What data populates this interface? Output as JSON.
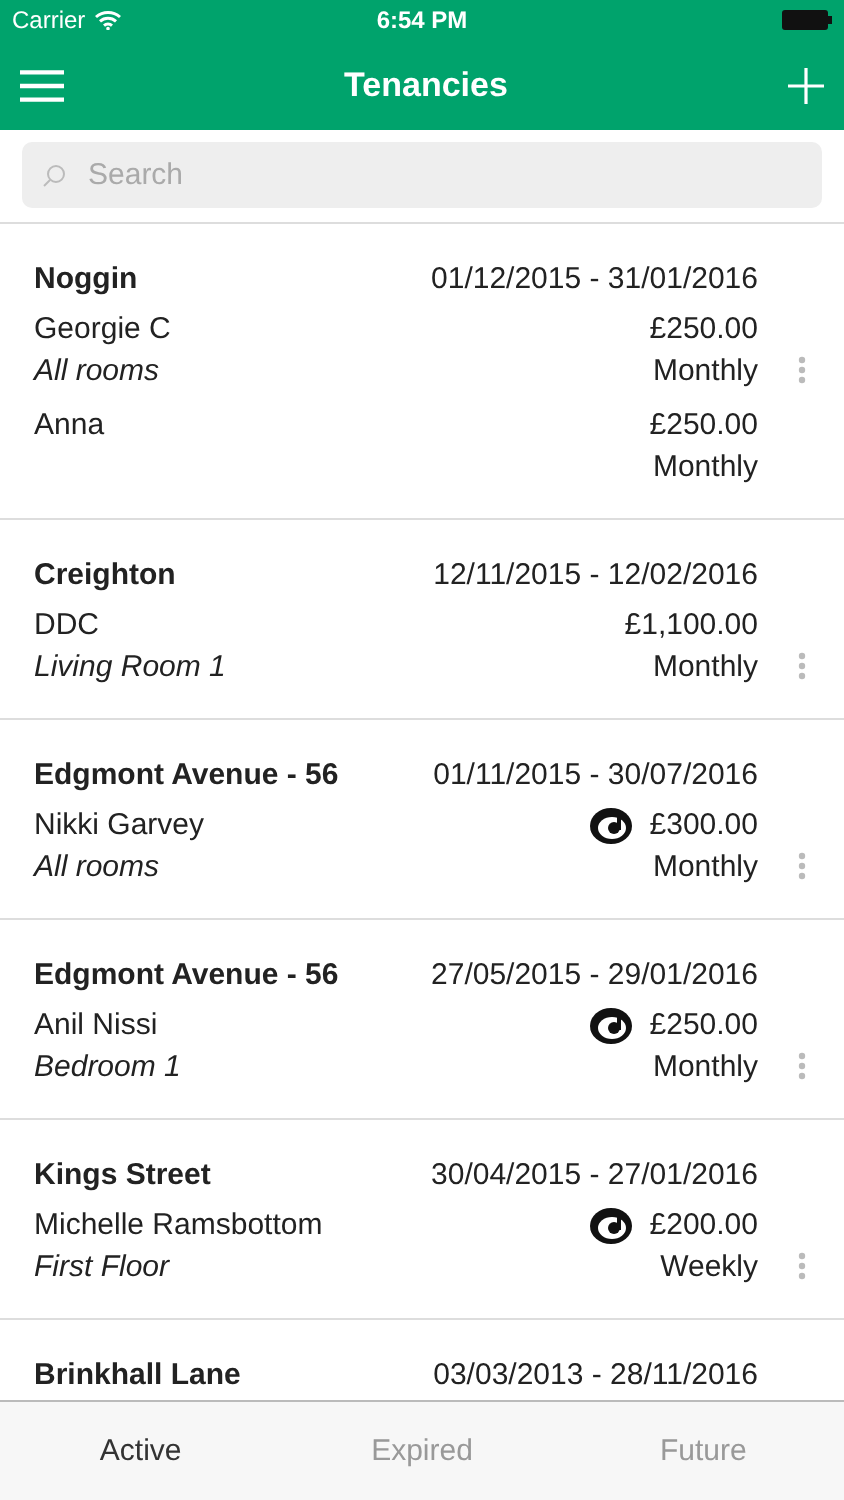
{
  "status_bar": {
    "carrier": "Carrier",
    "time": "6:54 PM"
  },
  "nav_bar": {
    "title": "Tenancies"
  },
  "search": {
    "placeholder": "Search"
  },
  "tenancies": [
    {
      "property": "Noggin",
      "dates": "01/12/2015 - 31/01/2016",
      "tenants": [
        {
          "name": "Georgie C",
          "room": "All rooms",
          "rent": "£250.00",
          "period": "Monthly",
          "deposit": false
        },
        {
          "name": "Anna",
          "rent": "£250.00",
          "period": "Monthly",
          "deposit": false
        }
      ]
    },
    {
      "property": "Creighton",
      "dates": "12/11/2015 - 12/02/2016",
      "tenants": [
        {
          "name": "DDC",
          "room": "Living Room 1",
          "rent": "£1,100.00",
          "period": "Monthly",
          "deposit": false
        }
      ]
    },
    {
      "property": "Edgmont Avenue - 56",
      "dates": "01/11/2015 - 30/07/2016",
      "tenants": [
        {
          "name": "Nikki Garvey",
          "room": "All rooms",
          "rent": "£300.00",
          "period": "Monthly",
          "deposit": true
        }
      ]
    },
    {
      "property": "Edgmont Avenue - 56",
      "dates": "27/05/2015 - 29/01/2016",
      "tenants": [
        {
          "name": "Anil Nissi",
          "room": "Bedroom 1",
          "rent": "£250.00",
          "period": "Monthly",
          "deposit": true
        }
      ]
    },
    {
      "property": "Kings Street",
      "dates": "30/04/2015 - 27/01/2016",
      "tenants": [
        {
          "name": "Michelle Ramsbottom",
          "room": "First Floor",
          "rent": "£200.00",
          "period": "Weekly",
          "deposit": true
        }
      ]
    },
    {
      "property": "Brinkhall Lane",
      "dates": "03/03/2013 - 28/11/2016"
    }
  ],
  "tabs": [
    {
      "label": "Active",
      "selected": true
    },
    {
      "label": "Expired",
      "selected": false
    },
    {
      "label": "Future",
      "selected": false
    }
  ]
}
